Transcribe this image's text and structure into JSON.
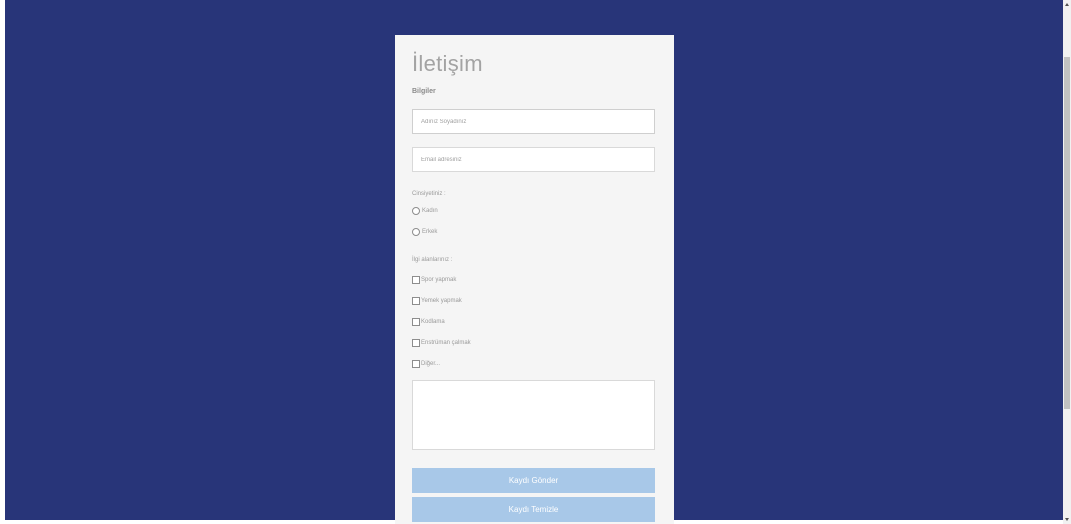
{
  "form": {
    "title": "İletişim",
    "subtitle": "Bilgiler",
    "name_placeholder": "Adınız Soyadınız",
    "email_placeholder": "Email adresiniz",
    "gender_label": "Cinsiyetiniz :",
    "gender_options": [
      "Kadın",
      "Erkek"
    ],
    "hobby_label": "İlgi alanlarınız :",
    "hobby_options": [
      "Spor yapmak",
      "Yemek yapmak",
      "Kodlama",
      "Enstrüman çalmak",
      "Diğer..."
    ],
    "message_value": "",
    "submit_label": "Kaydı Gönder",
    "reset_label": "Kaydı Temizle"
  },
  "colors": {
    "background": "#283579",
    "card": "#f5f5f5",
    "button": "#a8c8e8"
  }
}
